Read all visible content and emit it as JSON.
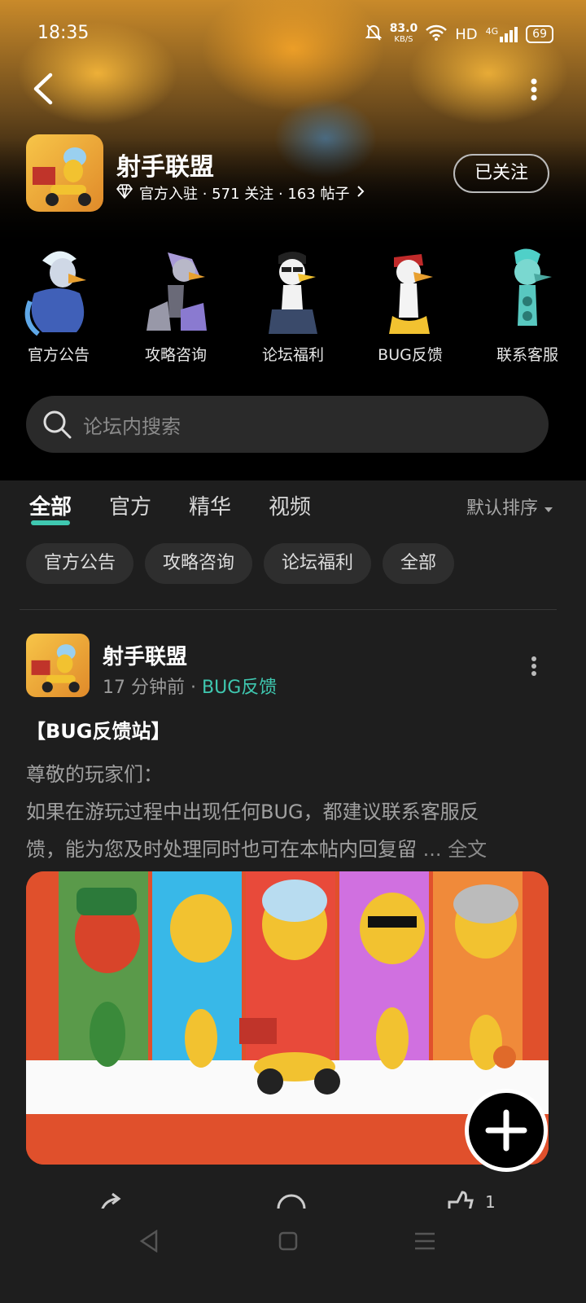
{
  "status_bar": {
    "time": "18:35",
    "net_speed": "83.0",
    "net_unit": "KB/S",
    "hd": "HD",
    "signal": "4G",
    "battery": "69"
  },
  "header": {
    "app_name": "射手联盟",
    "meta": "官方入驻 · 571 关注 · 163 帖子",
    "follow_label": "已关注"
  },
  "shortcuts": [
    {
      "label": "官方公告",
      "color": "#5fa8e8"
    },
    {
      "label": "攻略咨询",
      "color": "#9a7ad8"
    },
    {
      "label": "论坛福利",
      "color": "#f2c230"
    },
    {
      "label": "BUG反馈",
      "color": "#e8e8e8"
    },
    {
      "label": "联系客服",
      "color": "#4fd0c8"
    }
  ],
  "search": {
    "placeholder": "论坛内搜索"
  },
  "tabs": [
    "全部",
    "官方",
    "精华",
    "视频"
  ],
  "sort_label": "默认排序",
  "chips": [
    "官方公告",
    "攻略咨询",
    "论坛福利",
    "全部"
  ],
  "post": {
    "author": "射手联盟",
    "time": "17 分钟前",
    "dot": "·",
    "tag": "BUG反馈",
    "title": "【BUG反馈站】",
    "line1": "尊敬的玩家们：",
    "line2": " 如果在游玩过程中出现任何BUG，都建议联系客服反",
    "line3": "馈，能为您及时处理同时也可在本帖内回复留",
    "ellipsis": "... 全文",
    "reaction_count": "1"
  },
  "colors": {
    "accent": "#3fc8b0",
    "background": "#1e1e1e"
  }
}
